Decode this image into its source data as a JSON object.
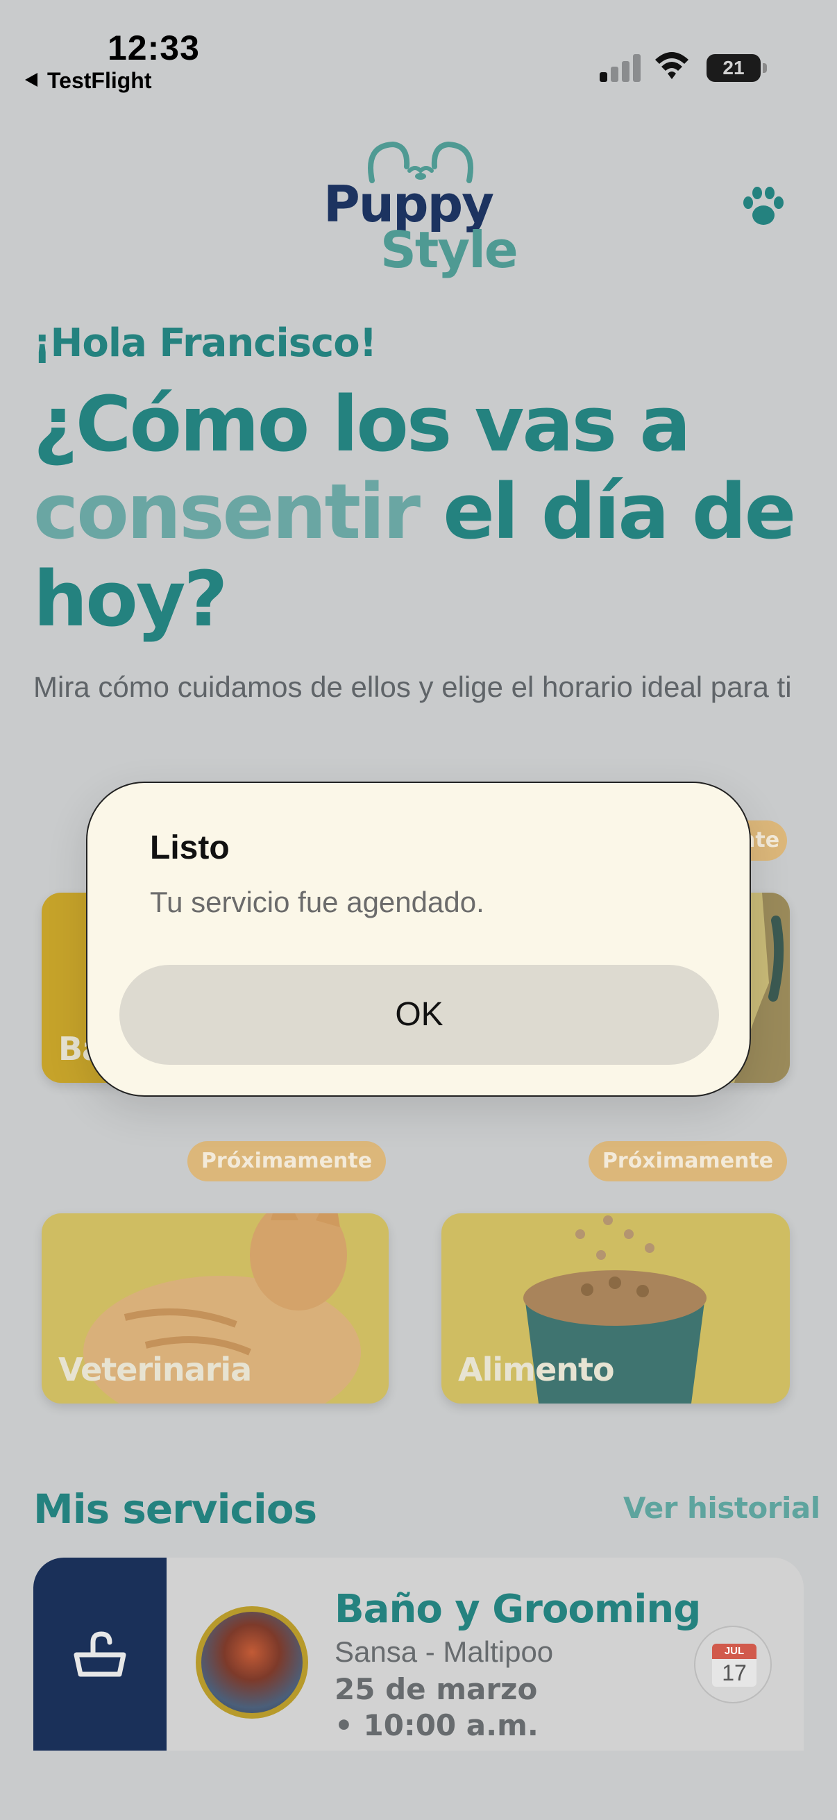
{
  "status_bar": {
    "time": "12:33",
    "back_app": "TestFlight",
    "battery": "21"
  },
  "header": {
    "logo_line1": "Puppy",
    "logo_line2": "Style",
    "paw_icon": "paw-icon"
  },
  "hero": {
    "greeting": "¡Hola Francisco!",
    "headline_part1": "¿Cómo los vas a ",
    "headline_highlight": "consentir",
    "headline_part2": " el día de hoy?",
    "subtitle": "Mira cómo cuidamos de ellos y elige el horario ideal para ti"
  },
  "cards": [
    {
      "label": "Baño y Grooming",
      "visible_label": "Ba",
      "badge": ""
    },
    {
      "label": "",
      "badge": "Próximamente"
    },
    {
      "label": "Veterinaria",
      "badge": "Próximamente"
    },
    {
      "label": "Alimento",
      "badge": "Próximamente"
    }
  ],
  "services": {
    "title": "Mis servicios",
    "history_link": "Ver historial",
    "item": {
      "name": "Baño y Grooming",
      "pet": "Sansa  -  Maltipoo",
      "date": "25 de marzo • 10:00 a.m.",
      "calendar_month": "JUL",
      "calendar_day": "17"
    }
  },
  "dialog": {
    "title": "Listo",
    "message": "Tu servicio fue agendado.",
    "button": "OK"
  },
  "colors": {
    "teal": "#24827f",
    "navy": "#1c3360",
    "card_yellow": "#cfbd62",
    "badge": "#dcb77a"
  }
}
